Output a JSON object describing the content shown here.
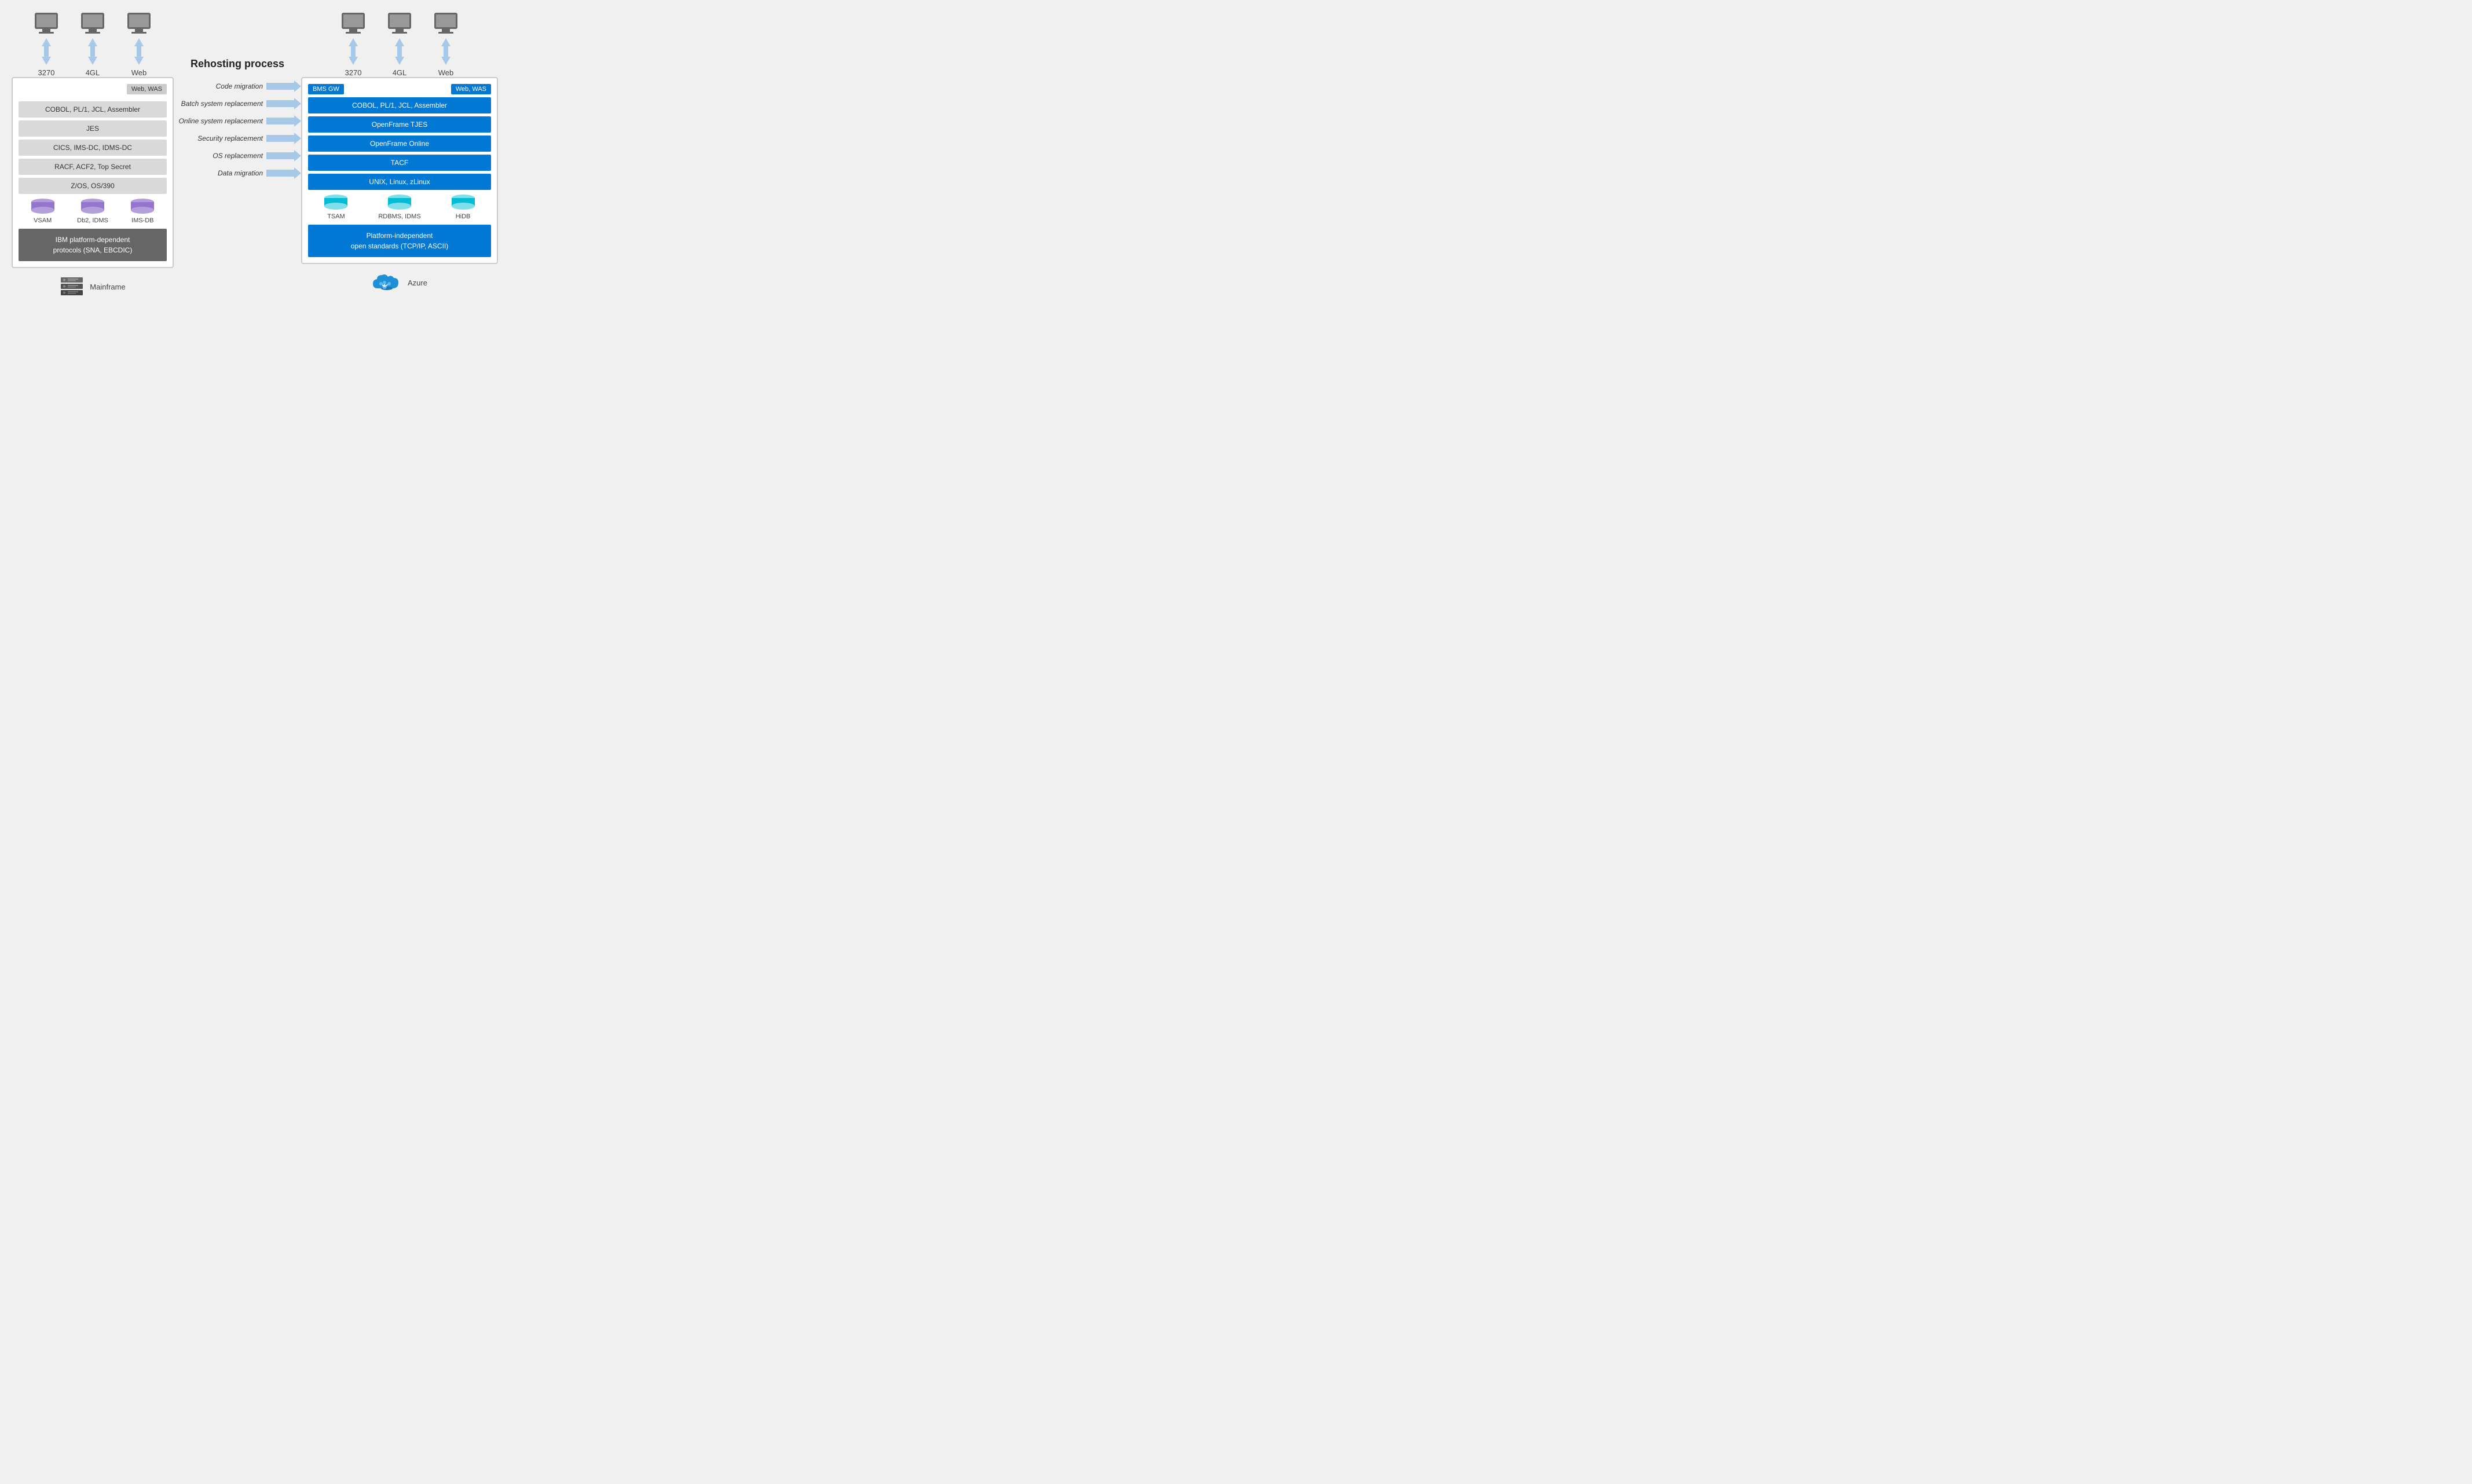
{
  "left": {
    "terminals": [
      {
        "label": "3270"
      },
      {
        "label": "4GL"
      },
      {
        "label": "Web"
      }
    ],
    "web_was": "Web, WAS",
    "bars": [
      "COBOL, PL/1, JCL, Assembler",
      "JES",
      "CICS, IMS-DC, IDMS-DC",
      "RACF, ACF2, Top Secret",
      "Z/OS, OS/390"
    ],
    "databases": [
      {
        "label": "VSAM",
        "color": "purple"
      },
      {
        "label": "Db2, IDMS",
        "color": "purple"
      },
      {
        "label": "IMS-DB",
        "color": "purple"
      }
    ],
    "ibm_box": "IBM platform-dependent\nprotocols (SNA, EBCDIC)",
    "bottom_label": "Mainframe"
  },
  "middle": {
    "title": "Rehosting process",
    "steps": [
      "Code migration",
      "Batch system replacement",
      "Online system replacement",
      "Security replacement",
      "OS replacement",
      "Data migration"
    ]
  },
  "right": {
    "terminals": [
      {
        "label": "3270"
      },
      {
        "label": "4GL"
      },
      {
        "label": "Web"
      }
    ],
    "bms_gw": "BMS GW",
    "web_was": "Web, WAS",
    "bars": [
      "COBOL, PL/1, JCL, Assembler",
      "OpenFrame TJES",
      "OpenFrame Online",
      "TACF",
      "UNIX, Linux, zLinux"
    ],
    "databases": [
      {
        "label": "TSAM",
        "color": "cyan"
      },
      {
        "label": "RDBMS, IDMS",
        "color": "cyan"
      },
      {
        "label": "HiDB",
        "color": "cyan"
      }
    ],
    "platform_box": "Platform-independent\nopen standards (TCP/IP, ASCII)",
    "bottom_label": "Azure"
  }
}
